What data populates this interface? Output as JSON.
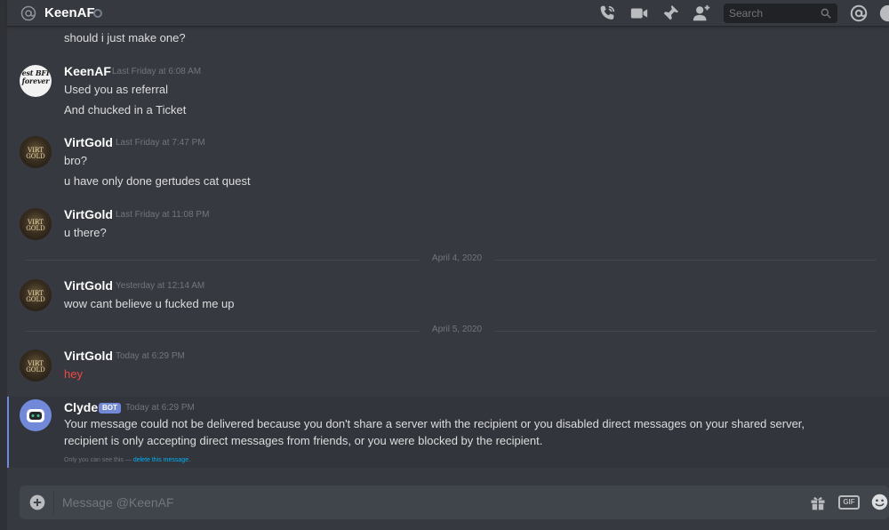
{
  "header": {
    "title": "KeenAF",
    "search_placeholder": "Search"
  },
  "messages": [
    {
      "continuation_text": "should i just make one?"
    },
    {
      "author": "KeenAF",
      "timestamp": "Last Friday at 6:08 AM",
      "avatar_text": "est BFI forever",
      "lines": [
        "Used you as referral",
        "And chucked in a Ticket"
      ]
    },
    {
      "author": "VirtGold",
      "timestamp": "Last Friday at 7:47 PM",
      "avatar_text": "VIRT GOLD",
      "lines": [
        "bro?",
        "u have only done gertudes cat quest"
      ]
    },
    {
      "author": "VirtGold",
      "timestamp": "Last Friday at 11:08 PM",
      "avatar_text": "VIRT GOLD",
      "lines": [
        "u there?"
      ]
    },
    {
      "author": "VirtGold",
      "timestamp": "Yesterday at 12:14 AM",
      "avatar_text": "VIRT GOLD",
      "lines": [
        "wow cant believe u fucked me up"
      ]
    },
    {
      "author": "VirtGold",
      "timestamp": "Today at 6:29 PM",
      "avatar_text": "VIRT GOLD",
      "lines": [
        "hey"
      ],
      "line_color": "#f04747"
    },
    {
      "author": "Clyde",
      "badge": "BOT",
      "timestamp": "Today at 6:29 PM",
      "lines": [
        "Your message could not be delivered because you don't share a server with the recipient or you disabled direct messages on your shared server,",
        "recipient is only accepting direct messages from friends, or you were blocked by the recipient."
      ],
      "note": "Only you can see this —",
      "note_link": "delete this message."
    }
  ],
  "dividers": [
    "April 4, 2020",
    "April 5, 2020"
  ],
  "composer": {
    "placeholder": "Message @KeenAF",
    "gif_label": "GIF"
  },
  "colors": {
    "background": "#36393f",
    "blurple": "#7289da",
    "error_red": "#f04747",
    "link": "#00b0f4"
  }
}
